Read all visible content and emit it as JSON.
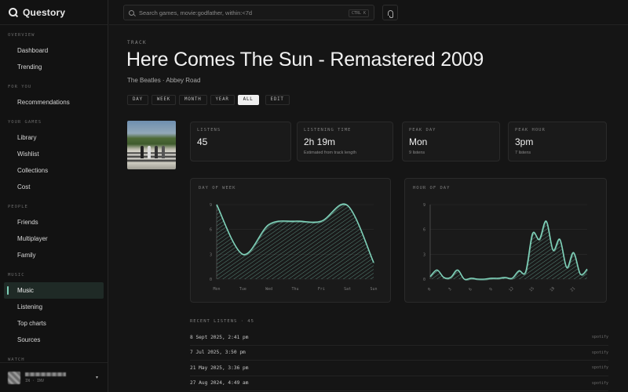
{
  "app": {
    "name": "Questory"
  },
  "search": {
    "placeholder": "Search games, movie:godfather, within:<7d",
    "shortcut": "CTRL K"
  },
  "sidebar": {
    "sections": [
      {
        "title": "OVERVIEW",
        "items": [
          "Dashboard",
          "Trending"
        ]
      },
      {
        "title": "FOR YOU",
        "items": [
          "Recommendations"
        ]
      },
      {
        "title": "YOUR GAMES",
        "items": [
          "Library",
          "Wishlist",
          "Collections",
          "Cost"
        ]
      },
      {
        "title": "PEOPLE",
        "items": [
          "Friends",
          "Multiplayer",
          "Family"
        ]
      },
      {
        "title": "MUSIC",
        "items": [
          "Music",
          "Listening",
          "Top charts",
          "Sources"
        ]
      },
      {
        "title": "WATCH",
        "items": []
      }
    ],
    "active": "Music",
    "user": {
      "sub": "IN · INV"
    }
  },
  "page": {
    "eyebrow": "TRACK",
    "title": "Here Comes The Sun - Remastered 2009",
    "subtitle": "The Beatles · Abbey Road",
    "tabs": [
      "DAY",
      "WEEK",
      "MONTH",
      "YEAR",
      "ALL"
    ],
    "active_tab": "ALL",
    "edit_label": "EDIT"
  },
  "stats": [
    {
      "label": "LISTENS",
      "value": "45",
      "note": ""
    },
    {
      "label": "LISTENING TIME",
      "value": "2h 19m",
      "note": "Estimated from track length"
    },
    {
      "label": "PEAK DAY",
      "value": "Mon",
      "note": "9 listens"
    },
    {
      "label": "PEAK HOUR",
      "value": "3pm",
      "note": "7 listens"
    }
  ],
  "chart_data": [
    {
      "type": "area",
      "title": "DAY OF WEEK",
      "categories": [
        "Mon",
        "Tue",
        "Wed",
        "Thu",
        "Fri",
        "Sat",
        "Sun"
      ],
      "values": [
        9,
        3,
        6.6,
        7,
        7,
        8.9,
        2
      ],
      "yticks": [
        0,
        3,
        6,
        9
      ],
      "ylim": [
        0,
        9
      ],
      "color": "#7fd1b9"
    },
    {
      "type": "area",
      "title": "HOUR OF DAY",
      "x": [
        0,
        1,
        2,
        3,
        4,
        5,
        6,
        7,
        8,
        9,
        10,
        11,
        12,
        13,
        14,
        15,
        16,
        17,
        18,
        19,
        20,
        21,
        22,
        23
      ],
      "values": [
        0.3,
        1.1,
        0.2,
        0.2,
        1.1,
        0,
        0.1,
        0,
        0,
        0.1,
        0.1,
        0.2,
        0.1,
        1.0,
        0.9,
        5.5,
        4.8,
        7,
        3.5,
        4.8,
        1.4,
        3.2,
        0.6,
        1.2
      ],
      "yticks": [
        0,
        3,
        6,
        9
      ],
      "ylim": [
        0,
        9
      ],
      "color": "#7fd1b9"
    }
  ],
  "recent": {
    "title": "RECENT LISTENS · 45",
    "rows": [
      {
        "date": "8 Sept 2025, 2:41 pm",
        "source": "spotify"
      },
      {
        "date": "7 Jul 2025, 3:50 pm",
        "source": "spotify"
      },
      {
        "date": "21 May 2025, 3:36 pm",
        "source": "spotify"
      },
      {
        "date": "27 Aug 2024, 4:49 am",
        "source": "spotify"
      }
    ]
  }
}
